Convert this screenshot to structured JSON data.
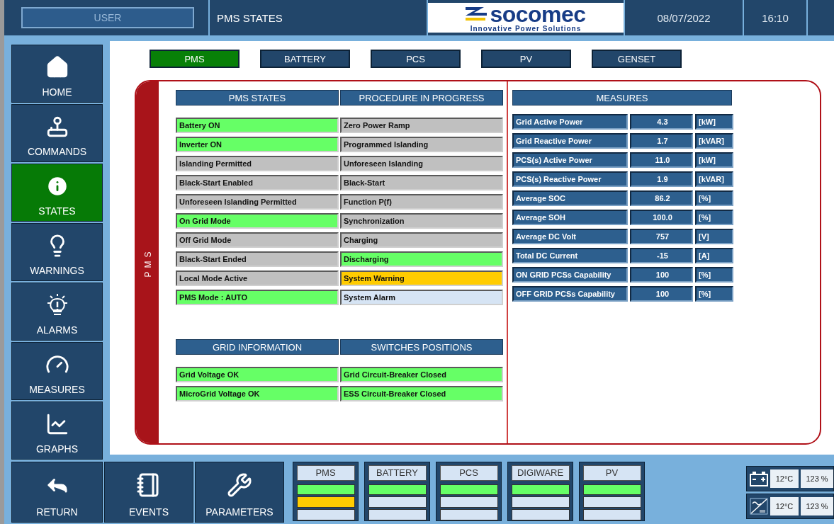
{
  "header": {
    "user_field": "USER",
    "title": "PMS STATES",
    "logo": {
      "name": "socomec",
      "tagline": "Innovative Power Solutions"
    },
    "date": "08/07/2022",
    "time": "16:10"
  },
  "sidebar": {
    "items": [
      {
        "label": "HOME",
        "selected": false
      },
      {
        "label": "COMMANDS",
        "selected": false
      },
      {
        "label": "STATES",
        "selected": true
      },
      {
        "label": "WARNINGS",
        "selected": false
      },
      {
        "label": "ALARMS",
        "selected": false
      },
      {
        "label": "MEASURES",
        "selected": false
      },
      {
        "label": "GRAPHS",
        "selected": false
      }
    ]
  },
  "tabs": [
    {
      "label": "PMS",
      "selected": true
    },
    {
      "label": "BATTERY",
      "selected": false
    },
    {
      "label": "PCS",
      "selected": false
    },
    {
      "label": "PV",
      "selected": false
    },
    {
      "label": "GENSET",
      "selected": false
    }
  ],
  "panel": {
    "label": "PMS",
    "states_table": {
      "columns": [
        "PMS STATES",
        "PROCEDURE IN PROGRESS"
      ],
      "rows": [
        [
          {
            "text": "Battery ON",
            "kind": "on"
          },
          {
            "text": "Zero Power Ramp",
            "kind": "off"
          }
        ],
        [
          {
            "text": "Inverter ON",
            "kind": "on"
          },
          {
            "text": "Programmed Islanding",
            "kind": "off"
          }
        ],
        [
          {
            "text": "Islanding Permitted",
            "kind": "off"
          },
          {
            "text": "Unforeseen Islanding",
            "kind": "off"
          }
        ],
        [
          {
            "text": "Black-Start Enabled",
            "kind": "off"
          },
          {
            "text": "Black-Start",
            "kind": "off"
          }
        ],
        [
          {
            "text": "Unforeseen Islanding Permitted",
            "kind": "off"
          },
          {
            "text": "Function P(f)",
            "kind": "off"
          }
        ],
        [
          {
            "text": "On Grid Mode",
            "kind": "on"
          },
          {
            "text": "Synchronization",
            "kind": "off"
          }
        ],
        [
          {
            "text": "Off Grid Mode",
            "kind": "off"
          },
          {
            "text": "Charging",
            "kind": "off"
          }
        ],
        [
          {
            "text": "Black-Start Ended",
            "kind": "off"
          },
          {
            "text": "Discharging",
            "kind": "on"
          }
        ],
        [
          {
            "text": "Local Mode Active",
            "kind": "off"
          },
          {
            "text": "System Warning",
            "kind": "warning"
          }
        ],
        [
          {
            "text": "PMS Mode : AUTO",
            "kind": "on"
          },
          {
            "text": "System Alarm",
            "kind": "inactive"
          }
        ]
      ]
    },
    "grid_table": {
      "columns": [
        "GRID INFORMATION",
        "SWITCHES POSITIONS"
      ],
      "rows": [
        [
          {
            "text": "Grid Voltage OK",
            "kind": "on"
          },
          {
            "text": "Grid Circuit-Breaker Closed",
            "kind": "on"
          }
        ],
        [
          {
            "text": "MicroGrid Voltage OK",
            "kind": "on"
          },
          {
            "text": "ESS Circuit-Breaker Closed",
            "kind": "on"
          }
        ]
      ]
    },
    "measures": {
      "title": "MEASURES",
      "rows": [
        {
          "name": "Grid Active Power",
          "value": "4.3",
          "unit": "[kW]"
        },
        {
          "name": "Grid Reactive Power",
          "value": "1.7",
          "unit": "[kVAR]"
        },
        {
          "name": "PCS(s) Active Power",
          "value": "11.0",
          "unit": "[kW]"
        },
        {
          "name": "PCS(s) Reactive Power",
          "value": "1.9",
          "unit": "[kVAR]"
        },
        {
          "name": "Average SOC",
          "value": "86.2",
          "unit": "[%]"
        },
        {
          "name": "Average SOH",
          "value": "100.0",
          "unit": "[%]"
        },
        {
          "name": "Average DC Volt",
          "value": "757",
          "unit": "[V]"
        },
        {
          "name": "Total DC Current",
          "value": "-15",
          "unit": "[A]"
        },
        {
          "name": "ON GRID PCSs Capability",
          "value": "100",
          "unit": "[%]"
        },
        {
          "name": "OFF GRID PCSs Capability",
          "value": "100",
          "unit": "[%]"
        }
      ]
    }
  },
  "bottom": {
    "buttons": [
      {
        "label": "RETURN"
      },
      {
        "label": "EVENTS"
      },
      {
        "label": "PARAMETERS"
      }
    ],
    "modules": [
      {
        "label": "PMS",
        "lights": [
          {
            "kind": "on"
          },
          {
            "kind": "warning"
          },
          {
            "kind": "off"
          }
        ]
      },
      {
        "label": "BATTERY",
        "lights": [
          {
            "kind": "on"
          },
          {
            "kind": "off"
          },
          {
            "kind": "off"
          }
        ]
      },
      {
        "label": "PCS",
        "lights": [
          {
            "kind": "on"
          },
          {
            "kind": "off"
          },
          {
            "kind": "off"
          }
        ]
      },
      {
        "label": "DIGIWARE",
        "lights": [
          {
            "kind": "on"
          },
          {
            "kind": "off"
          },
          {
            "kind": "off"
          }
        ]
      },
      {
        "label": "PV",
        "lights": [
          {
            "kind": "on"
          },
          {
            "kind": "off"
          },
          {
            "kind": "off"
          }
        ]
      }
    ],
    "sensors": [
      {
        "temperature": "12°C",
        "reading": "123 %"
      },
      {
        "temperature": "12°C",
        "reading": "123 %"
      }
    ]
  }
}
